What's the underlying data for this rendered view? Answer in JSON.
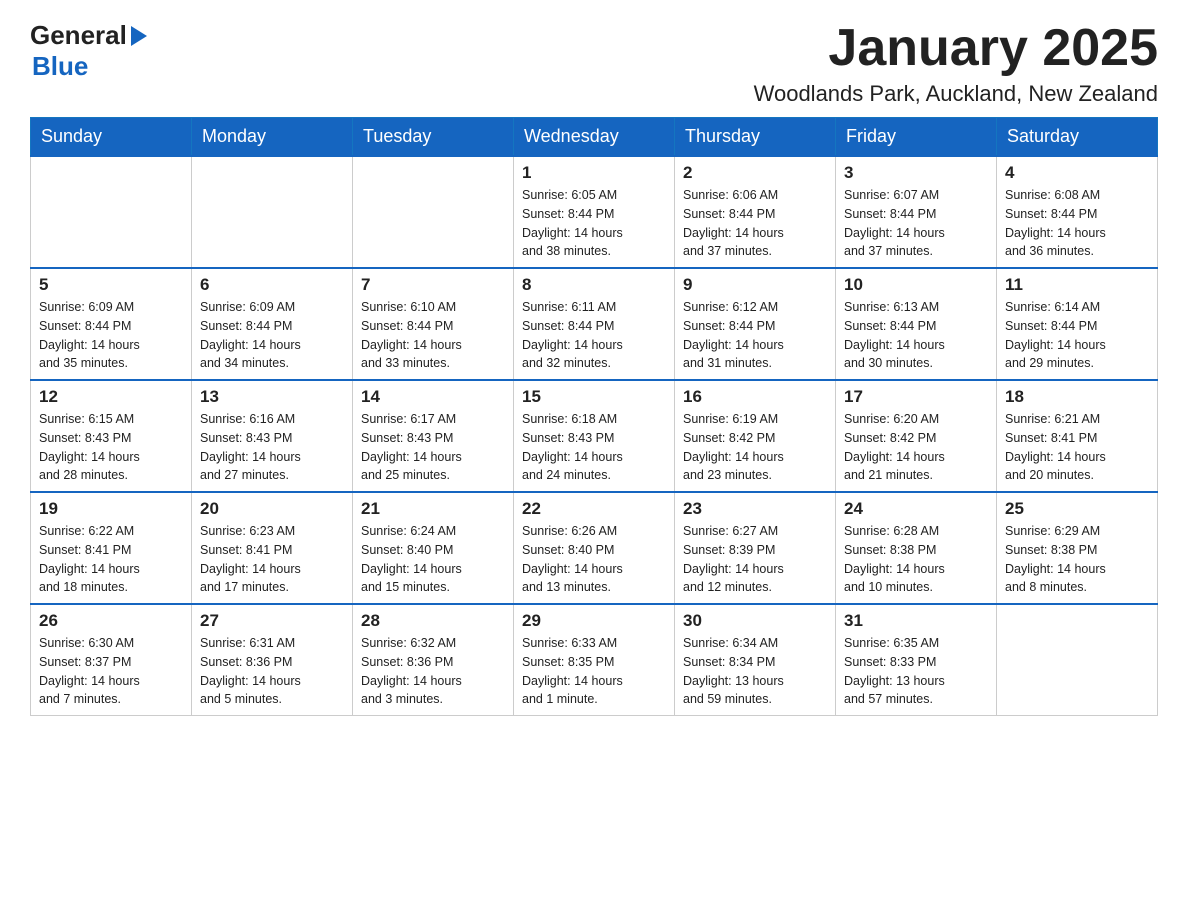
{
  "header": {
    "logo_general": "General",
    "logo_blue": "Blue",
    "month_year": "January 2025",
    "location": "Woodlands Park, Auckland, New Zealand"
  },
  "weekdays": [
    "Sunday",
    "Monday",
    "Tuesday",
    "Wednesday",
    "Thursday",
    "Friday",
    "Saturday"
  ],
  "weeks": [
    [
      {
        "day": "",
        "info": ""
      },
      {
        "day": "",
        "info": ""
      },
      {
        "day": "",
        "info": ""
      },
      {
        "day": "1",
        "info": "Sunrise: 6:05 AM\nSunset: 8:44 PM\nDaylight: 14 hours\nand 38 minutes."
      },
      {
        "day": "2",
        "info": "Sunrise: 6:06 AM\nSunset: 8:44 PM\nDaylight: 14 hours\nand 37 minutes."
      },
      {
        "day": "3",
        "info": "Sunrise: 6:07 AM\nSunset: 8:44 PM\nDaylight: 14 hours\nand 37 minutes."
      },
      {
        "day": "4",
        "info": "Sunrise: 6:08 AM\nSunset: 8:44 PM\nDaylight: 14 hours\nand 36 minutes."
      }
    ],
    [
      {
        "day": "5",
        "info": "Sunrise: 6:09 AM\nSunset: 8:44 PM\nDaylight: 14 hours\nand 35 minutes."
      },
      {
        "day": "6",
        "info": "Sunrise: 6:09 AM\nSunset: 8:44 PM\nDaylight: 14 hours\nand 34 minutes."
      },
      {
        "day": "7",
        "info": "Sunrise: 6:10 AM\nSunset: 8:44 PM\nDaylight: 14 hours\nand 33 minutes."
      },
      {
        "day": "8",
        "info": "Sunrise: 6:11 AM\nSunset: 8:44 PM\nDaylight: 14 hours\nand 32 minutes."
      },
      {
        "day": "9",
        "info": "Sunrise: 6:12 AM\nSunset: 8:44 PM\nDaylight: 14 hours\nand 31 minutes."
      },
      {
        "day": "10",
        "info": "Sunrise: 6:13 AM\nSunset: 8:44 PM\nDaylight: 14 hours\nand 30 minutes."
      },
      {
        "day": "11",
        "info": "Sunrise: 6:14 AM\nSunset: 8:44 PM\nDaylight: 14 hours\nand 29 minutes."
      }
    ],
    [
      {
        "day": "12",
        "info": "Sunrise: 6:15 AM\nSunset: 8:43 PM\nDaylight: 14 hours\nand 28 minutes."
      },
      {
        "day": "13",
        "info": "Sunrise: 6:16 AM\nSunset: 8:43 PM\nDaylight: 14 hours\nand 27 minutes."
      },
      {
        "day": "14",
        "info": "Sunrise: 6:17 AM\nSunset: 8:43 PM\nDaylight: 14 hours\nand 25 minutes."
      },
      {
        "day": "15",
        "info": "Sunrise: 6:18 AM\nSunset: 8:43 PM\nDaylight: 14 hours\nand 24 minutes."
      },
      {
        "day": "16",
        "info": "Sunrise: 6:19 AM\nSunset: 8:42 PM\nDaylight: 14 hours\nand 23 minutes."
      },
      {
        "day": "17",
        "info": "Sunrise: 6:20 AM\nSunset: 8:42 PM\nDaylight: 14 hours\nand 21 minutes."
      },
      {
        "day": "18",
        "info": "Sunrise: 6:21 AM\nSunset: 8:41 PM\nDaylight: 14 hours\nand 20 minutes."
      }
    ],
    [
      {
        "day": "19",
        "info": "Sunrise: 6:22 AM\nSunset: 8:41 PM\nDaylight: 14 hours\nand 18 minutes."
      },
      {
        "day": "20",
        "info": "Sunrise: 6:23 AM\nSunset: 8:41 PM\nDaylight: 14 hours\nand 17 minutes."
      },
      {
        "day": "21",
        "info": "Sunrise: 6:24 AM\nSunset: 8:40 PM\nDaylight: 14 hours\nand 15 minutes."
      },
      {
        "day": "22",
        "info": "Sunrise: 6:26 AM\nSunset: 8:40 PM\nDaylight: 14 hours\nand 13 minutes."
      },
      {
        "day": "23",
        "info": "Sunrise: 6:27 AM\nSunset: 8:39 PM\nDaylight: 14 hours\nand 12 minutes."
      },
      {
        "day": "24",
        "info": "Sunrise: 6:28 AM\nSunset: 8:38 PM\nDaylight: 14 hours\nand 10 minutes."
      },
      {
        "day": "25",
        "info": "Sunrise: 6:29 AM\nSunset: 8:38 PM\nDaylight: 14 hours\nand 8 minutes."
      }
    ],
    [
      {
        "day": "26",
        "info": "Sunrise: 6:30 AM\nSunset: 8:37 PM\nDaylight: 14 hours\nand 7 minutes."
      },
      {
        "day": "27",
        "info": "Sunrise: 6:31 AM\nSunset: 8:36 PM\nDaylight: 14 hours\nand 5 minutes."
      },
      {
        "day": "28",
        "info": "Sunrise: 6:32 AM\nSunset: 8:36 PM\nDaylight: 14 hours\nand 3 minutes."
      },
      {
        "day": "29",
        "info": "Sunrise: 6:33 AM\nSunset: 8:35 PM\nDaylight: 14 hours\nand 1 minute."
      },
      {
        "day": "30",
        "info": "Sunrise: 6:34 AM\nSunset: 8:34 PM\nDaylight: 13 hours\nand 59 minutes."
      },
      {
        "day": "31",
        "info": "Sunrise: 6:35 AM\nSunset: 8:33 PM\nDaylight: 13 hours\nand 57 minutes."
      },
      {
        "day": "",
        "info": ""
      }
    ]
  ]
}
